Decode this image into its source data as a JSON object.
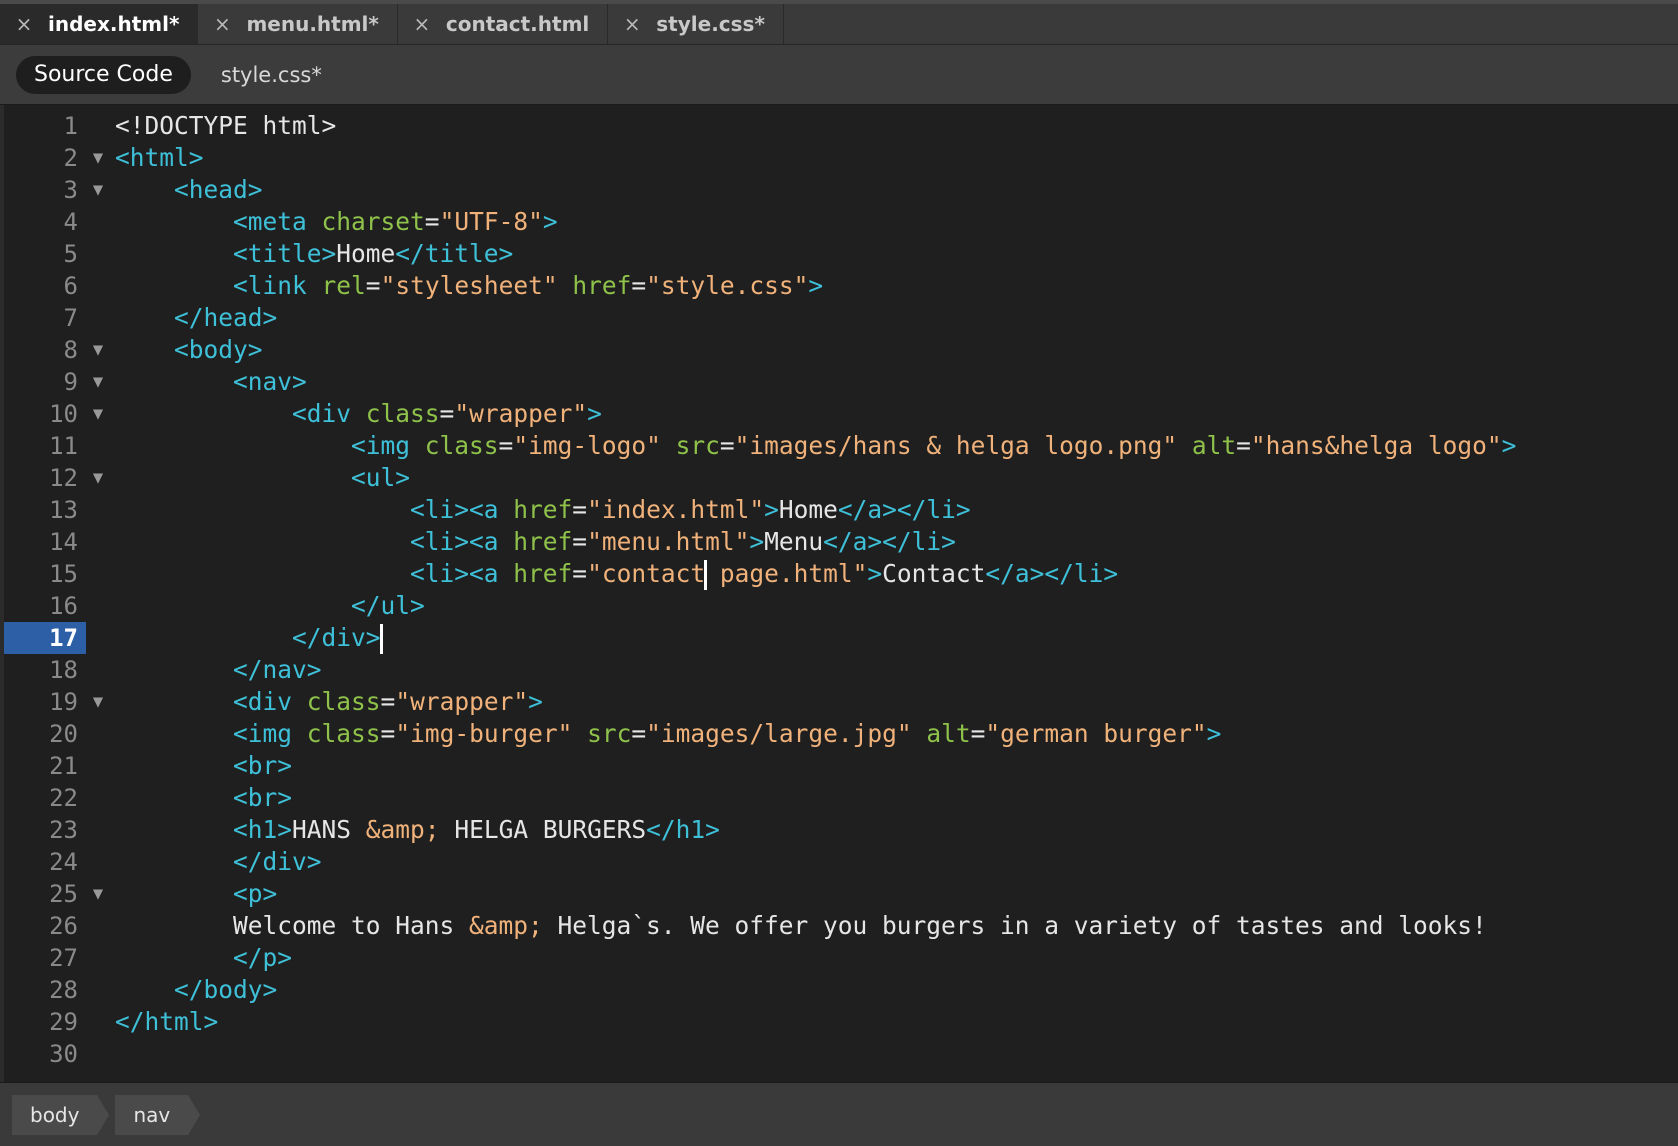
{
  "tabs": [
    {
      "label": "index.html*",
      "active": true
    },
    {
      "label": "menu.html*",
      "active": false
    },
    {
      "label": "contact.html",
      "active": false
    },
    {
      "label": "style.css*",
      "active": false
    }
  ],
  "subbar": {
    "source_code_label": "Source Code",
    "related_file": "style.css*"
  },
  "editor": {
    "current_line": 17,
    "lines": [
      {
        "num": "1",
        "fold": false
      },
      {
        "num": "2",
        "fold": true
      },
      {
        "num": "3",
        "fold": true
      },
      {
        "num": "4",
        "fold": false
      },
      {
        "num": "5",
        "fold": false
      },
      {
        "num": "6",
        "fold": false
      },
      {
        "num": "7",
        "fold": false
      },
      {
        "num": "8",
        "fold": true
      },
      {
        "num": "9",
        "fold": true
      },
      {
        "num": "10",
        "fold": true
      },
      {
        "num": "11",
        "fold": false
      },
      {
        "num": "12",
        "fold": true
      },
      {
        "num": "13",
        "fold": false
      },
      {
        "num": "14",
        "fold": false
      },
      {
        "num": "15",
        "fold": false
      },
      {
        "num": "16",
        "fold": false
      },
      {
        "num": "17",
        "fold": false
      },
      {
        "num": "18",
        "fold": false
      },
      {
        "num": "19",
        "fold": true
      },
      {
        "num": "20",
        "fold": false
      },
      {
        "num": "21",
        "fold": false
      },
      {
        "num": "22",
        "fold": false
      },
      {
        "num": "23",
        "fold": false
      },
      {
        "num": "24",
        "fold": false
      },
      {
        "num": "25",
        "fold": true
      },
      {
        "num": "26",
        "fold": false
      },
      {
        "num": "27",
        "fold": false
      },
      {
        "num": "28",
        "fold": false
      },
      {
        "num": "29",
        "fold": false
      },
      {
        "num": "30",
        "fold": false
      }
    ],
    "fold_glyph": "▼",
    "code": {
      "l1": [
        "<!DOCTYPE html>"
      ],
      "l2": [
        "<html>"
      ],
      "l3": [
        "<head>"
      ],
      "l4": [
        "<meta",
        " charset",
        "=",
        "\"UTF-8\"",
        ">"
      ],
      "l5": [
        "<title>",
        "Home",
        "</title>"
      ],
      "l6": [
        "<link",
        " rel",
        "=",
        "\"stylesheet\"",
        " href",
        "=",
        "\"style.css\"",
        ">"
      ],
      "l7": [
        "</head>"
      ],
      "l8": [
        "<body>"
      ],
      "l9": [
        "<nav>"
      ],
      "l10": [
        "<div",
        " class",
        "=",
        "\"wrapper\"",
        ">"
      ],
      "l11": [
        "<img",
        " class",
        "=",
        "\"img-logo\"",
        " src",
        "=",
        "\"images/hans & helga logo.png\"",
        " alt",
        "=",
        "\"hans&helga logo\"",
        ">"
      ],
      "l12": [
        "<ul>"
      ],
      "l13": [
        "<li><a",
        " href",
        "=",
        "\"index.html\"",
        ">",
        "Home",
        "</a></li>"
      ],
      "l14": [
        "<li><a",
        " href",
        "=",
        "\"menu.html\"",
        ">",
        "Menu",
        "</a></li>"
      ],
      "l15": [
        "<li><a",
        " href",
        "=",
        "\"contact",
        " page.html\"",
        ">",
        "Contact",
        "</a></li>"
      ],
      "l16": [
        "</ul>"
      ],
      "l17": [
        "</div>"
      ],
      "l18": [
        "</nav>"
      ],
      "l19": [
        "<div",
        " class",
        "=",
        "\"wrapper\"",
        ">"
      ],
      "l20": [
        "<img",
        " class",
        "=",
        "\"img-burger\"",
        " src",
        "=",
        "\"images/large.jpg\"",
        " alt",
        "=",
        "\"german burger\"",
        ">"
      ],
      "l21": [
        "<br>"
      ],
      "l22": [
        "<br>"
      ],
      "l23": [
        "<h1>",
        "HANS ",
        "&amp;",
        " HELGA BURGERS",
        "</h1>"
      ],
      "l24": [
        "</div>"
      ],
      "l25": [
        "<p>"
      ],
      "l26": [
        "Welcome to Hans ",
        "&amp;",
        " Helga`s. We offer you burgers in a variety of tastes and looks!"
      ],
      "l27": [
        "</p>"
      ],
      "l28": [
        "</body>"
      ],
      "l29": [
        "</html>"
      ],
      "l30": [
        ""
      ]
    }
  },
  "breadcrumbs": [
    "body",
    "nav"
  ],
  "colors": {
    "tag": "#3ec0d8",
    "attr": "#8fc24a",
    "value": "#f0b27a",
    "plain": "#e6e6e6",
    "current_line": "#2d5fa6"
  },
  "icons": {
    "tab_close": "close-icon",
    "fold": "fold-triangle-icon"
  }
}
